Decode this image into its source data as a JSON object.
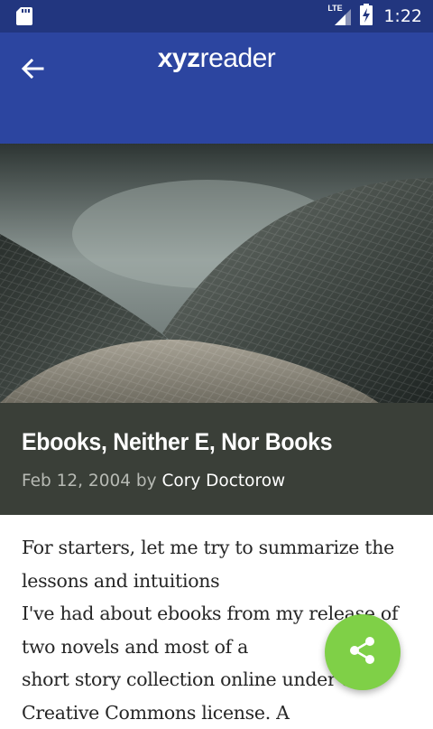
{
  "status_bar": {
    "network": "LTE",
    "time": "1:22"
  },
  "app_bar": {
    "logo_bold": "xyz",
    "logo_regular": "reader",
    "back_icon": "arrow-back-icon"
  },
  "article": {
    "title": "Ebooks, Neither E, Nor Books",
    "date": "Feb 12, 2004",
    "by": "by",
    "author": "Cory Doctorow",
    "body_lines": [
      "For starters, let me try to summarize the",
      "lessons and intuitions",
      "I've had about ebooks from my release of",
      "two novels and most of a",
      "short story collection online under a",
      "Creative Commons license. A"
    ]
  },
  "fab": {
    "icon": "share-icon",
    "color": "#7fd047"
  },
  "colors": {
    "status_bar": "#22367f",
    "app_bar": "#2c45a0",
    "meta_bar": "#3a3f38"
  }
}
